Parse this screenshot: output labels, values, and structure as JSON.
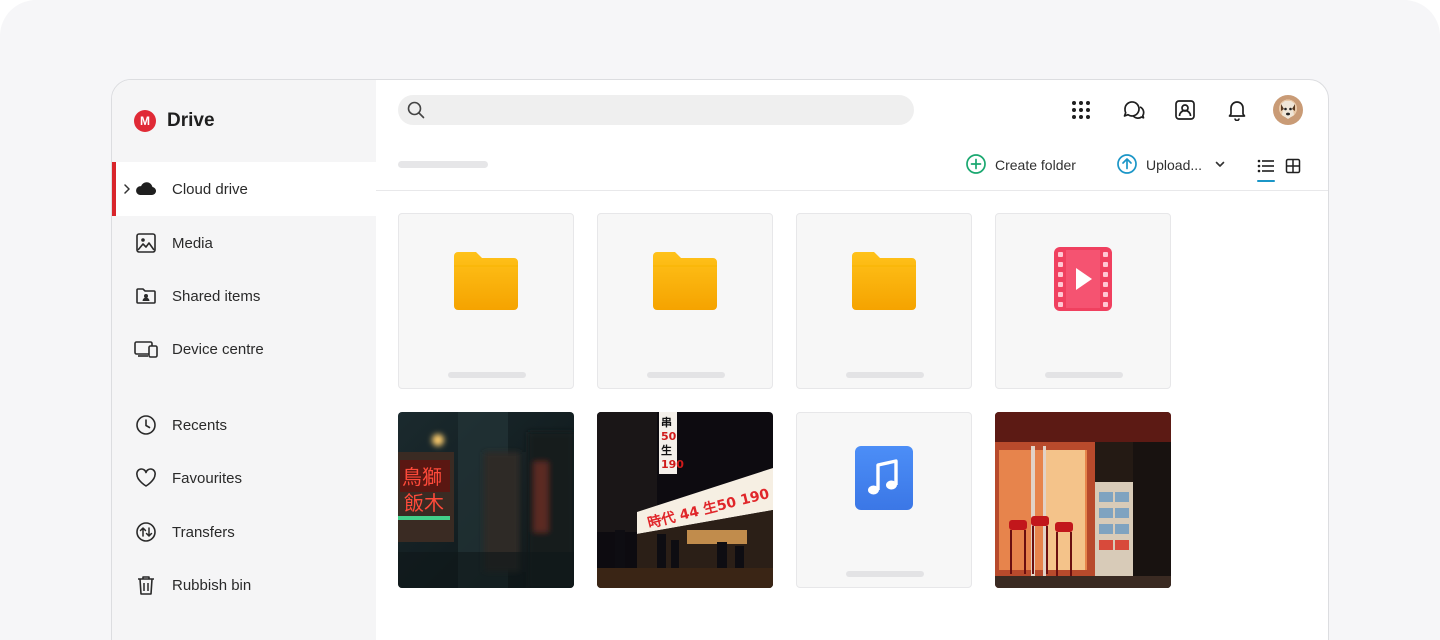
{
  "app": {
    "title": "Drive",
    "logo_letter": "M",
    "brand_color": "#e02a36"
  },
  "sidebar": {
    "items": [
      {
        "label": "Cloud drive",
        "icon": "cloud-icon",
        "active": true
      },
      {
        "label": "Media",
        "icon": "image-icon"
      },
      {
        "label": "Shared items",
        "icon": "shared-folder-icon"
      },
      {
        "label": "Device centre",
        "icon": "devices-icon"
      },
      {
        "label": "Recents",
        "icon": "clock-icon"
      },
      {
        "label": "Favourites",
        "icon": "heart-icon"
      },
      {
        "label": "Transfers",
        "icon": "transfers-icon"
      },
      {
        "label": "Rubbish bin",
        "icon": "trash-icon"
      }
    ]
  },
  "topbar": {
    "search_placeholder": "",
    "icons": [
      "apps-grid-icon",
      "chat-icon",
      "contacts-icon",
      "bell-icon"
    ]
  },
  "toolbar": {
    "create_folder_label": "Create folder",
    "upload_label": "Upload...",
    "create_folder_color": "#1aa870",
    "upload_color": "#1b96c7",
    "view_active": "list"
  },
  "files": [
    {
      "type": "folder",
      "icon": "folder-icon"
    },
    {
      "type": "folder",
      "icon": "folder-icon"
    },
    {
      "type": "folder",
      "icon": "folder-icon"
    },
    {
      "type": "video",
      "icon": "video-file-icon"
    },
    {
      "type": "photo",
      "icon": "photo-thumbnail"
    },
    {
      "type": "photo",
      "icon": "photo-thumbnail"
    },
    {
      "type": "audio",
      "icon": "audio-file-icon"
    },
    {
      "type": "photo",
      "icon": "photo-thumbnail"
    }
  ]
}
